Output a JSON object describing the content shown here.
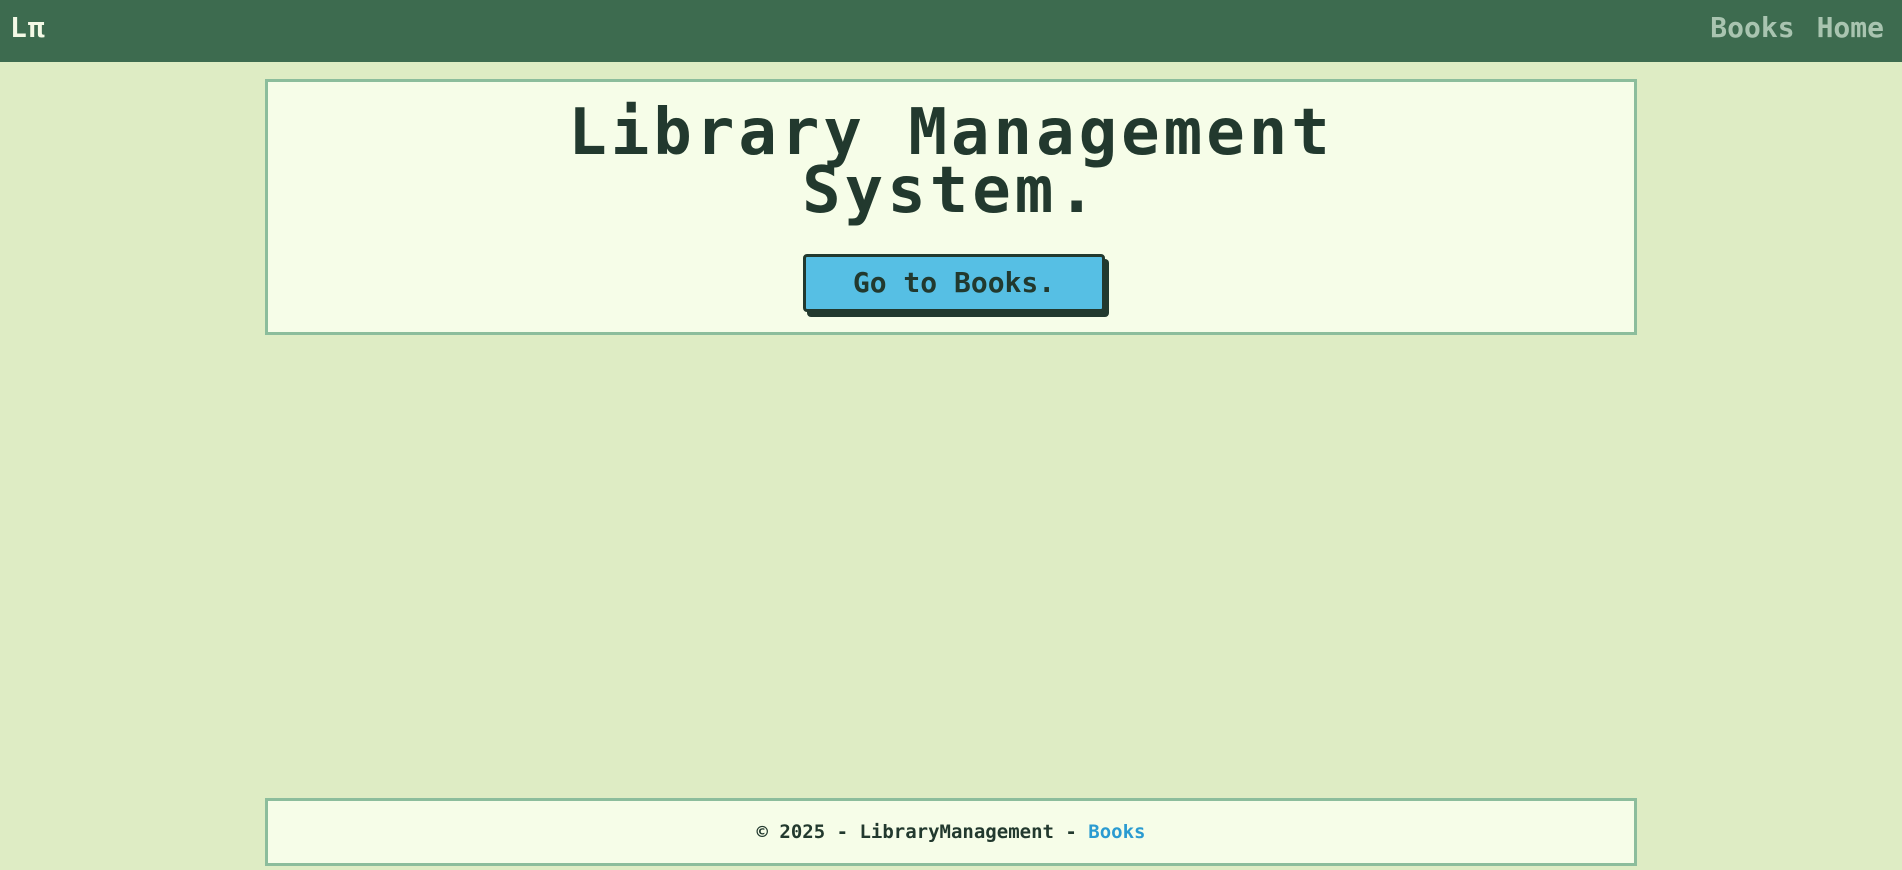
{
  "navbar": {
    "brand": "Lπ",
    "links": [
      {
        "label": "Books"
      },
      {
        "label": "Home"
      }
    ]
  },
  "hero": {
    "title_line1": "Library Management",
    "title_line2": "System.",
    "cta_label": "Go to Books."
  },
  "footer": {
    "copyright": "© 2025 - LibraryManagement - ",
    "link_label": "Books"
  },
  "colors": {
    "navbar_bg": "#3d6b4f",
    "page_bg": "#deecc4",
    "panel_bg": "#f6fde8",
    "panel_border": "#8cbd9c",
    "button_bg": "#56bfe4",
    "text_dark": "#22392e",
    "link": "#2a9bd1"
  }
}
